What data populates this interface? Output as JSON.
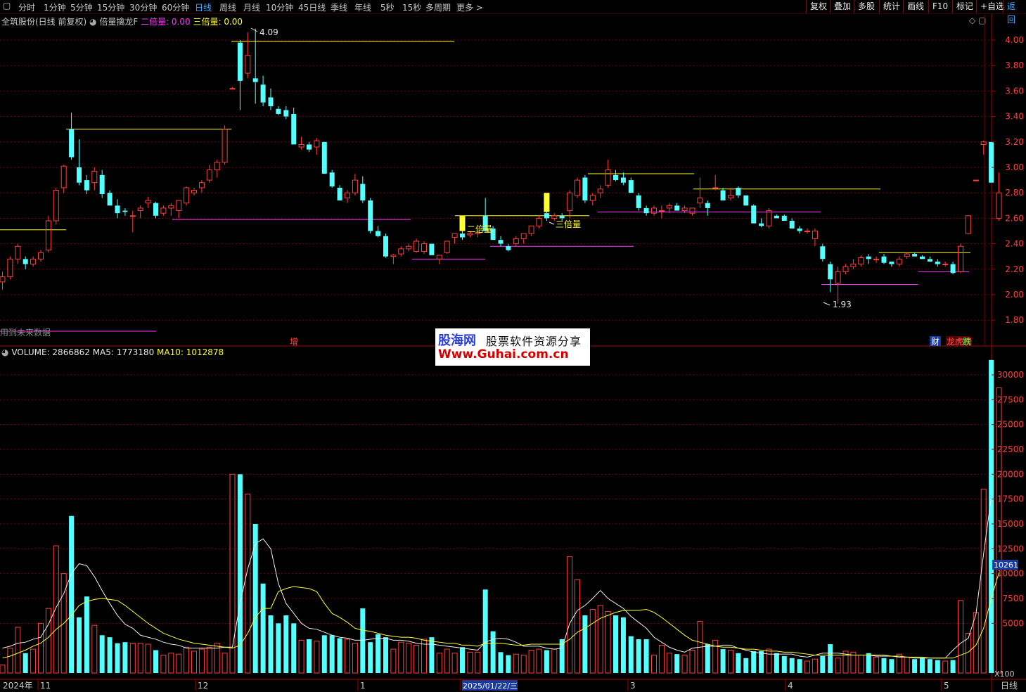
{
  "toolbar": {
    "periods": [
      "分时",
      "1分钟",
      "5分钟",
      "15分钟",
      "30分钟",
      "60分钟",
      "日线",
      "周线",
      "月线",
      "10分钟",
      "45日线",
      "季线",
      "年线",
      "5秒",
      "15秒",
      "多周期",
      "更多 >"
    ],
    "active_period": "日线",
    "right_buttons": [
      "复权",
      "叠加",
      "多股",
      "统计",
      "画线",
      "F10",
      "标记",
      "+自选",
      "返回"
    ]
  },
  "header": {
    "stock": "全筑股份(日线 前复权)",
    "indicator": "倍量擒龙F",
    "double_label": "二倍量: 0.00",
    "triple_label": "三倍量: 0.00"
  },
  "volume_header": {
    "volume": "VOLUME: 2866862",
    "ma5": "MA5: 1773180",
    "ma10": "MA10: 1012878"
  },
  "price_axis": {
    "ticks": [
      "4.00",
      "3.80",
      "3.60",
      "3.40",
      "3.20",
      "3.00",
      "2.80",
      "2.60",
      "2.40",
      "2.20",
      "2.00",
      "1.80"
    ]
  },
  "volume_axis": {
    "ticks": [
      "30000",
      "27500",
      "25000",
      "22500",
      "20000",
      "17500",
      "15000",
      "12500",
      "10000",
      "7500",
      "5000"
    ],
    "current": "10261",
    "unit": "X100"
  },
  "date_axis": {
    "labels": [
      "2024年",
      "11",
      "12",
      "1",
      "2025/01/22/三",
      "3",
      "4",
      "5"
    ],
    "period_label": "日线"
  },
  "annotations": {
    "high": "4.09",
    "low": "1.93",
    "double": "二倍量",
    "triple": "三倍量",
    "future_note": "用到未来数据",
    "zeng": "增",
    "cai": "财",
    "longhu": "龙虎榜",
    "die": "跌"
  },
  "watermark": {
    "logo": "股海网",
    "slogan": "股票软件资源分享",
    "url": "Www.Guhai.com.cn"
  },
  "colors": {
    "up": "#ff4040",
    "down": "#54ffff",
    "yellow": "#ffff33",
    "magenta": "#ff33ff",
    "grid": "#7a0000"
  },
  "chart_data": {
    "type": "candlestick",
    "title": "全筑股份(日线 前复权)",
    "y_range": [
      1.75,
      4.15
    ],
    "volume_range": [
      0,
      32000
    ],
    "candles": [
      [
        2.1,
        2.18,
        2.04,
        2.14,
        800
      ],
      [
        2.14,
        2.3,
        2.12,
        2.28,
        2500
      ],
      [
        2.28,
        2.4,
        2.24,
        2.38,
        4600
      ],
      [
        2.28,
        2.3,
        2.2,
        2.24,
        2000
      ],
      [
        2.24,
        2.3,
        2.22,
        2.28,
        2400
      ],
      [
        2.28,
        2.35,
        2.26,
        2.33,
        5000
      ],
      [
        2.35,
        2.62,
        2.33,
        2.58,
        6500
      ],
      [
        2.58,
        2.84,
        2.55,
        2.82,
        12800
      ],
      [
        2.84,
        3.02,
        2.8,
        3.01,
        10000
      ],
      [
        3.3,
        3.43,
        3.06,
        3.08,
        15800
      ],
      [
        3.0,
        3.22,
        2.86,
        2.88,
        5600
      ],
      [
        2.9,
        2.94,
        2.79,
        2.82,
        7700
      ],
      [
        2.88,
        3.0,
        2.82,
        2.97,
        4800
      ],
      [
        2.94,
        2.98,
        2.76,
        2.79,
        3800
      ],
      [
        2.8,
        2.82,
        2.7,
        2.7,
        3600
      ],
      [
        2.7,
        2.75,
        2.6,
        2.64,
        3000
      ],
      [
        2.66,
        2.68,
        2.62,
        2.65,
        3100
      ],
      [
        2.62,
        2.66,
        2.49,
        2.62,
        3000
      ],
      [
        2.66,
        2.7,
        2.6,
        2.68,
        3000
      ],
      [
        2.72,
        2.77,
        2.68,
        2.74,
        2900
      ],
      [
        2.72,
        2.73,
        2.6,
        2.62,
        2300
      ],
      [
        2.64,
        2.7,
        2.62,
        2.68,
        1800
      ],
      [
        2.68,
        2.72,
        2.62,
        2.7,
        2000
      ],
      [
        2.66,
        2.74,
        2.6,
        2.74,
        1900
      ],
      [
        2.72,
        2.85,
        2.7,
        2.84,
        2600
      ],
      [
        2.8,
        2.84,
        2.78,
        2.82,
        2200
      ],
      [
        2.84,
        2.9,
        2.8,
        2.88,
        2400
      ],
      [
        2.9,
        3.02,
        2.88,
        2.98,
        2600
      ],
      [
        2.98,
        3.06,
        2.92,
        3.04,
        3000
      ],
      [
        3.04,
        3.33,
        3.02,
        3.3,
        2000
      ],
      [
        3.62,
        3.63,
        3.62,
        3.62,
        20000
      ],
      [
        3.98,
        4.0,
        3.45,
        3.68,
        20000
      ],
      [
        3.74,
        4.06,
        3.7,
        3.88,
        18000
      ],
      [
        3.7,
        4.09,
        3.5,
        3.67,
        15000
      ],
      [
        3.65,
        3.72,
        3.48,
        3.51,
        9000
      ],
      [
        3.55,
        3.62,
        3.45,
        3.48,
        5800
      ],
      [
        3.46,
        3.48,
        3.41,
        3.42,
        5000
      ],
      [
        3.45,
        3.48,
        3.38,
        3.4,
        5800
      ],
      [
        3.42,
        3.47,
        3.18,
        3.18,
        5000
      ],
      [
        3.16,
        3.24,
        3.14,
        3.18,
        3300
      ],
      [
        3.18,
        3.2,
        3.12,
        3.14,
        3400
      ],
      [
        3.16,
        3.23,
        3.1,
        3.21,
        3200
      ],
      [
        3.2,
        3.2,
        2.95,
        2.95,
        3800
      ],
      [
        2.96,
        2.98,
        2.84,
        2.85,
        3800
      ],
      [
        2.84,
        2.86,
        2.74,
        2.74,
        3500
      ],
      [
        2.76,
        2.82,
        2.72,
        2.8,
        3400
      ],
      [
        2.8,
        2.95,
        2.78,
        2.9,
        3000
      ],
      [
        2.87,
        2.93,
        2.72,
        2.74,
        6500
      ],
      [
        2.74,
        2.76,
        2.48,
        2.5,
        3100
      ],
      [
        2.5,
        2.54,
        2.45,
        2.46,
        3900
      ],
      [
        2.46,
        2.48,
        2.29,
        2.3,
        3600
      ],
      [
        2.3,
        2.32,
        2.24,
        2.31,
        2400
      ],
      [
        2.32,
        2.38,
        2.3,
        2.36,
        3100
      ],
      [
        2.36,
        2.4,
        2.34,
        2.38,
        3000
      ],
      [
        2.34,
        2.44,
        2.33,
        2.42,
        2800
      ],
      [
        2.34,
        2.42,
        2.32,
        2.4,
        3400
      ],
      [
        2.4,
        2.4,
        2.31,
        2.31,
        3600
      ],
      [
        2.28,
        2.31,
        2.24,
        2.31,
        2000
      ],
      [
        2.33,
        2.42,
        2.32,
        2.42,
        2400
      ],
      [
        2.45,
        2.48,
        2.4,
        2.48,
        2000
      ],
      [
        2.48,
        2.5,
        2.43,
        2.45,
        2600
      ],
      [
        2.47,
        2.5,
        2.45,
        2.48,
        2100
      ],
      [
        2.48,
        2.5,
        2.45,
        2.49,
        2100
      ],
      [
        2.62,
        2.76,
        2.5,
        2.5,
        8400
      ],
      [
        2.52,
        2.54,
        2.43,
        2.43,
        4200
      ],
      [
        2.43,
        2.46,
        2.38,
        2.4,
        2100
      ],
      [
        2.38,
        2.4,
        2.34,
        2.35,
        1800
      ],
      [
        2.4,
        2.46,
        2.38,
        2.44,
        1900
      ],
      [
        2.44,
        2.48,
        2.4,
        2.48,
        1800
      ],
      [
        2.48,
        2.54,
        2.46,
        2.54,
        2300
      ],
      [
        2.54,
        2.62,
        2.52,
        2.6,
        2400
      ],
      [
        2.64,
        2.66,
        2.58,
        2.6,
        2300
      ],
      [
        2.6,
        2.64,
        2.58,
        2.62,
        2400
      ],
      [
        2.62,
        2.64,
        2.58,
        2.6,
        3400
      ],
      [
        2.66,
        2.82,
        2.6,
        2.8,
        11700
      ],
      [
        2.78,
        2.92,
        2.76,
        2.9,
        9400
      ],
      [
        2.92,
        2.94,
        2.72,
        2.74,
        5800
      ],
      [
        2.74,
        2.8,
        2.7,
        2.78,
        6400
      ],
      [
        2.8,
        2.86,
        2.76,
        2.83,
        6800
      ],
      [
        2.86,
        3.06,
        2.84,
        2.98,
        6200
      ],
      [
        2.94,
        2.98,
        2.89,
        2.9,
        5800
      ],
      [
        2.92,
        2.96,
        2.86,
        2.88,
        5600
      ],
      [
        2.9,
        2.92,
        2.8,
        2.8,
        3700
      ],
      [
        2.78,
        2.8,
        2.66,
        2.68,
        3400
      ],
      [
        2.68,
        2.7,
        2.62,
        2.64,
        3400
      ],
      [
        2.64,
        2.7,
        2.62,
        2.68,
        1800
      ],
      [
        2.66,
        2.7,
        2.6,
        2.66,
        2800
      ],
      [
        2.68,
        2.72,
        2.64,
        2.7,
        2000
      ],
      [
        2.7,
        2.72,
        2.66,
        2.66,
        1900
      ],
      [
        2.66,
        2.7,
        2.64,
        2.68,
        1800
      ],
      [
        2.64,
        2.68,
        2.62,
        2.68,
        2300
      ],
      [
        2.72,
        2.92,
        2.68,
        2.76,
        5200
      ],
      [
        2.72,
        2.74,
        2.62,
        2.68,
        2900
      ],
      [
        2.84,
        2.94,
        2.82,
        2.84,
        3300
      ],
      [
        2.82,
        2.84,
        2.74,
        2.74,
        2400
      ],
      [
        2.76,
        2.84,
        2.74,
        2.78,
        2300
      ],
      [
        2.84,
        2.85,
        2.76,
        2.78,
        2000
      ],
      [
        2.78,
        2.78,
        2.7,
        2.7,
        1500
      ],
      [
        2.7,
        2.71,
        2.56,
        2.56,
        2200
      ],
      [
        2.56,
        2.6,
        2.53,
        2.54,
        2200
      ],
      [
        2.54,
        2.68,
        2.52,
        2.66,
        2400
      ],
      [
        2.62,
        2.63,
        2.6,
        2.6,
        2000
      ],
      [
        2.62,
        2.63,
        2.58,
        2.58,
        1700
      ],
      [
        2.58,
        2.6,
        2.52,
        2.52,
        1500
      ],
      [
        2.52,
        2.54,
        2.48,
        2.5,
        1400
      ],
      [
        2.5,
        2.52,
        2.48,
        2.5,
        1200
      ],
      [
        2.44,
        2.52,
        2.38,
        2.5,
        1400
      ],
      [
        2.38,
        2.4,
        2.26,
        2.28,
        1700
      ],
      [
        2.24,
        2.26,
        2.02,
        2.12,
        2900
      ],
      [
        2.09,
        2.22,
        1.93,
        2.18,
        1500
      ],
      [
        2.18,
        2.24,
        2.16,
        2.22,
        2200
      ],
      [
        2.22,
        2.28,
        2.2,
        2.24,
        2100
      ],
      [
        2.24,
        2.31,
        2.22,
        2.29,
        1800
      ],
      [
        2.3,
        2.32,
        2.24,
        2.28,
        2000
      ],
      [
        2.28,
        2.3,
        2.25,
        2.28,
        1600
      ],
      [
        2.3,
        2.32,
        2.24,
        2.25,
        1500
      ],
      [
        2.26,
        2.26,
        2.22,
        2.24,
        1400
      ],
      [
        2.24,
        2.3,
        2.22,
        2.28,
        1900
      ],
      [
        2.3,
        2.33,
        2.28,
        2.32,
        1600
      ],
      [
        2.32,
        2.33,
        2.3,
        2.3,
        1400
      ],
      [
        2.3,
        2.31,
        2.28,
        2.28,
        1500
      ],
      [
        2.28,
        2.3,
        2.26,
        2.26,
        1400
      ],
      [
        2.26,
        2.28,
        2.22,
        2.24,
        1300
      ],
      [
        2.24,
        2.26,
        2.22,
        2.24,
        1200
      ],
      [
        2.24,
        2.26,
        2.16,
        2.17,
        1300
      ],
      [
        2.18,
        2.4,
        2.17,
        2.38,
        7300
      ],
      [
        2.48,
        2.62,
        2.48,
        2.62,
        4000
      ],
      [
        2.9,
        2.9,
        2.9,
        2.9,
        6100
      ],
      [
        3.18,
        3.21,
        3.1,
        3.2,
        18500
      ],
      [
        3.2,
        3.2,
        2.88,
        2.88,
        31500
      ],
      [
        2.6,
        2.96,
        2.58,
        2.8,
        28700
      ]
    ],
    "ma5": [
      2500,
      2700,
      3000,
      3100,
      3400,
      3600,
      4900,
      6600,
      8000,
      10000,
      11000,
      10800,
      9700,
      8300,
      7000,
      5800,
      4900,
      4500,
      3800,
      3600,
      3400,
      3100,
      2900,
      2800,
      2500,
      2500,
      2500,
      2500,
      2500,
      2600,
      2600,
      7000,
      10500,
      13000,
      13500,
      12500,
      9000,
      7000,
      6000,
      5000,
      4500,
      4400,
      4100,
      3800,
      3600,
      3500,
      3300,
      3300,
      3400,
      3500,
      3500,
      3300,
      3300,
      3200,
      3000,
      2900,
      2900,
      2800,
      2700,
      2600,
      2500,
      2400,
      2300,
      3100,
      3400,
      3500,
      3400,
      3100,
      2700,
      2700,
      2700,
      2500,
      2400,
      2500,
      5000,
      6300,
      6800,
      7500,
      8300,
      7500,
      7000,
      6500,
      5700,
      5100,
      4500,
      3600,
      3100,
      2600,
      2300,
      2100,
      2500,
      2600,
      2700,
      2700,
      2800,
      2800,
      2500,
      2300,
      2100,
      2000,
      1900,
      1900,
      1900,
      1900,
      1700,
      1600,
      1800,
      2000,
      2000,
      2000,
      1900,
      1800,
      1800,
      1800,
      1700,
      1700,
      1700,
      1600,
      1600,
      1500,
      1500,
      1500,
      1500,
      1500,
      2300,
      3000,
      3500,
      5900,
      12000,
      17700
    ],
    "ma10": [
      1500,
      1700,
      2000,
      2300,
      2700,
      3000,
      3600,
      4400,
      5000,
      5800,
      6800,
      7200,
      7400,
      7500,
      7400,
      7300,
      6800,
      6200,
      5600,
      5000,
      4500,
      4000,
      3700,
      3400,
      3200,
      3000,
      2900,
      2800,
      2700,
      2600,
      2500,
      2800,
      4000,
      5600,
      6500,
      6500,
      8200,
      8500,
      8700,
      8600,
      8500,
      8200,
      7000,
      6000,
      5600,
      5100,
      4500,
      4300,
      4200,
      4000,
      3800,
      3700,
      3600,
      3600,
      3500,
      3300,
      3200,
      3100,
      3000,
      3000,
      2800,
      2800,
      2700,
      3000,
      3000,
      3000,
      2900,
      2800,
      2800,
      2900,
      2900,
      2900,
      2900,
      2900,
      3400,
      4100,
      4500,
      5000,
      5500,
      5800,
      6100,
      6300,
      6300,
      6300,
      6400,
      6100,
      5600,
      5000,
      4400,
      3800,
      3300,
      3100,
      2900,
      2700,
      2600,
      2600,
      2500,
      2400,
      2400,
      2300,
      2200,
      2200,
      2100,
      2100,
      2000,
      1900,
      1800,
      1800,
      1800,
      1800,
      1800,
      1800,
      1800,
      1800,
      1800,
      1800,
      1700,
      1700,
      1600,
      1600,
      1600,
      1500,
      1500,
      1500,
      1500,
      1800,
      2100,
      2800,
      4500,
      7500,
      10100
    ]
  }
}
